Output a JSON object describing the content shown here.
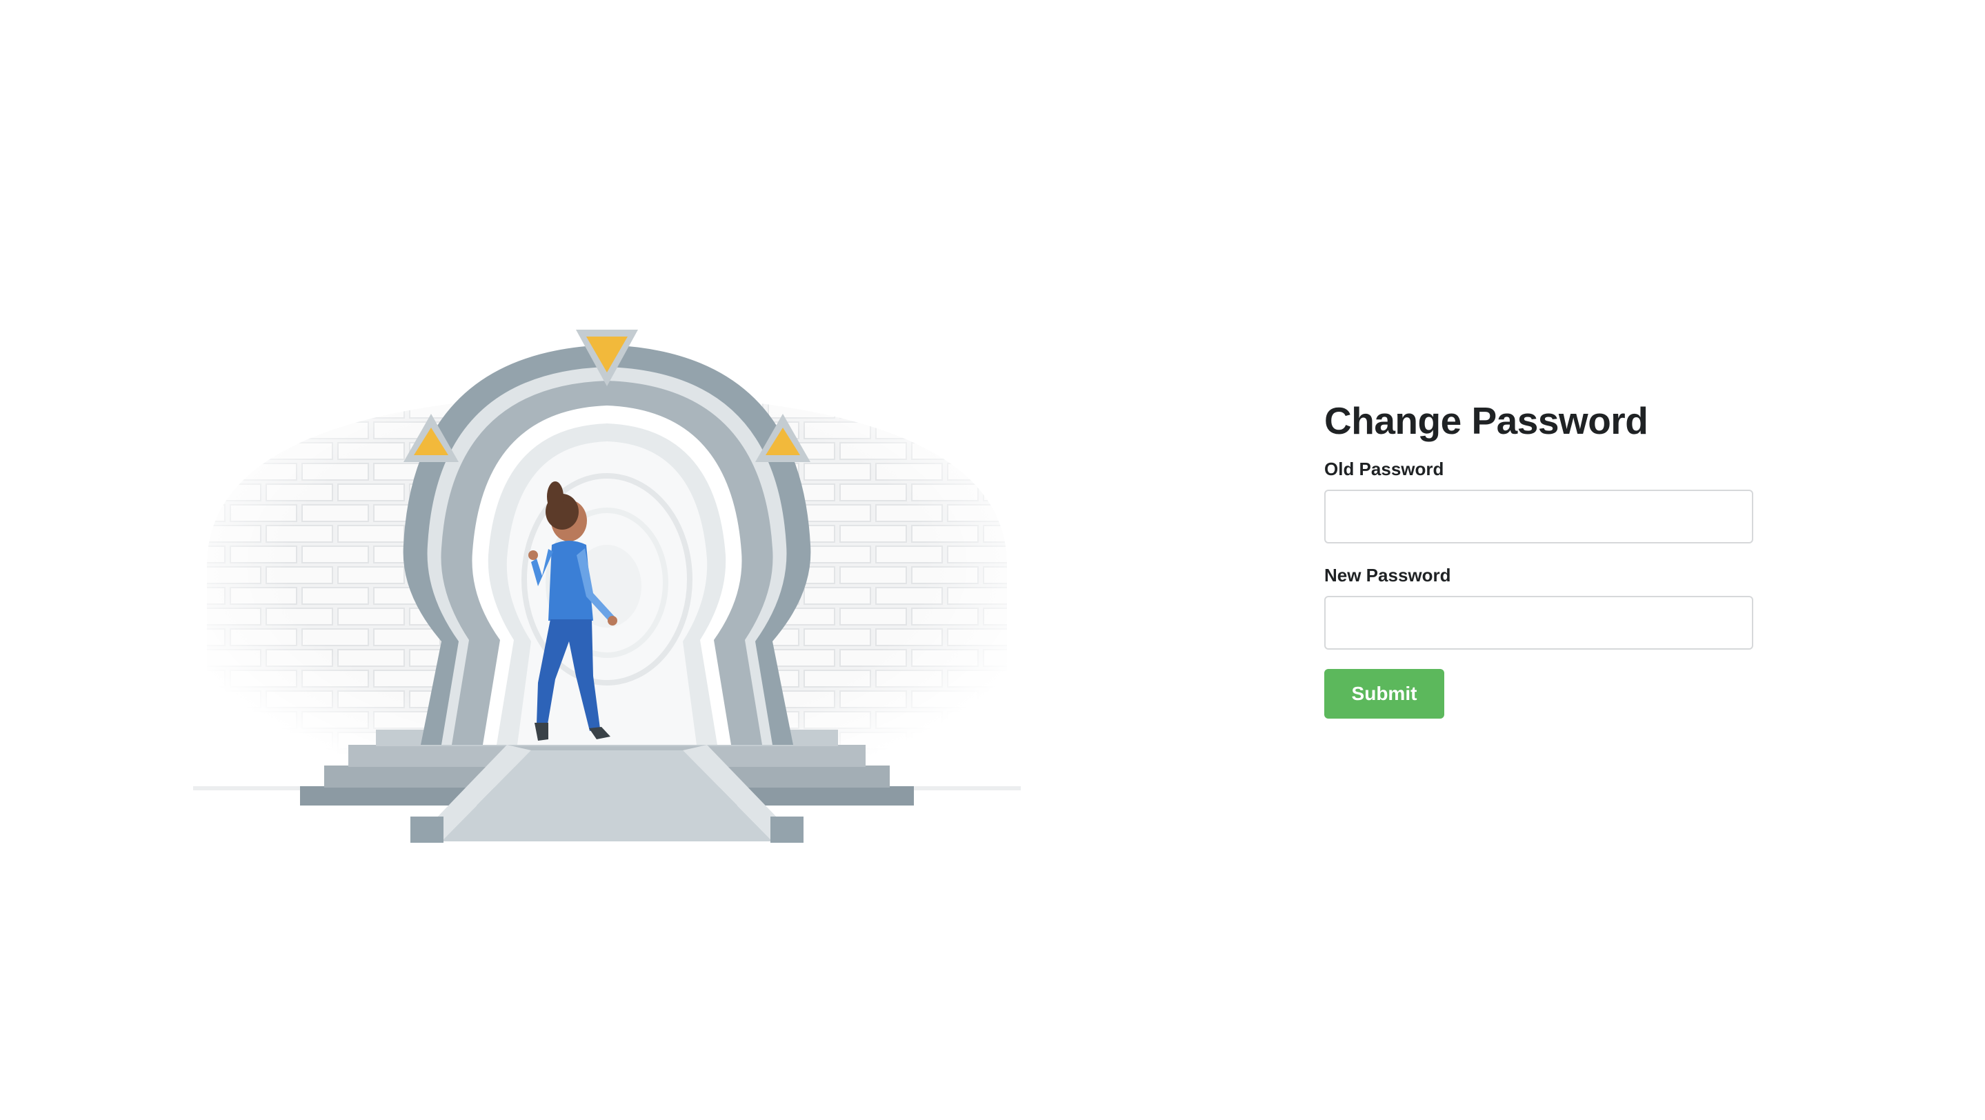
{
  "form": {
    "title": "Change Password",
    "old_password": {
      "label": "Old Password",
      "value": "",
      "placeholder": ""
    },
    "new_password": {
      "label": "New Password",
      "value": "",
      "placeholder": ""
    },
    "submit_label": "Submit"
  },
  "illustration": {
    "icon": "keyhole-portal-illustration"
  },
  "colors": {
    "submit_button": "#5cb85c",
    "title_text": "#1f2224",
    "input_border": "#d6d8da",
    "portal_gray": "#9aa6ae",
    "accent_yellow": "#f2b93b",
    "figure_blue": "#3b7fd6"
  }
}
